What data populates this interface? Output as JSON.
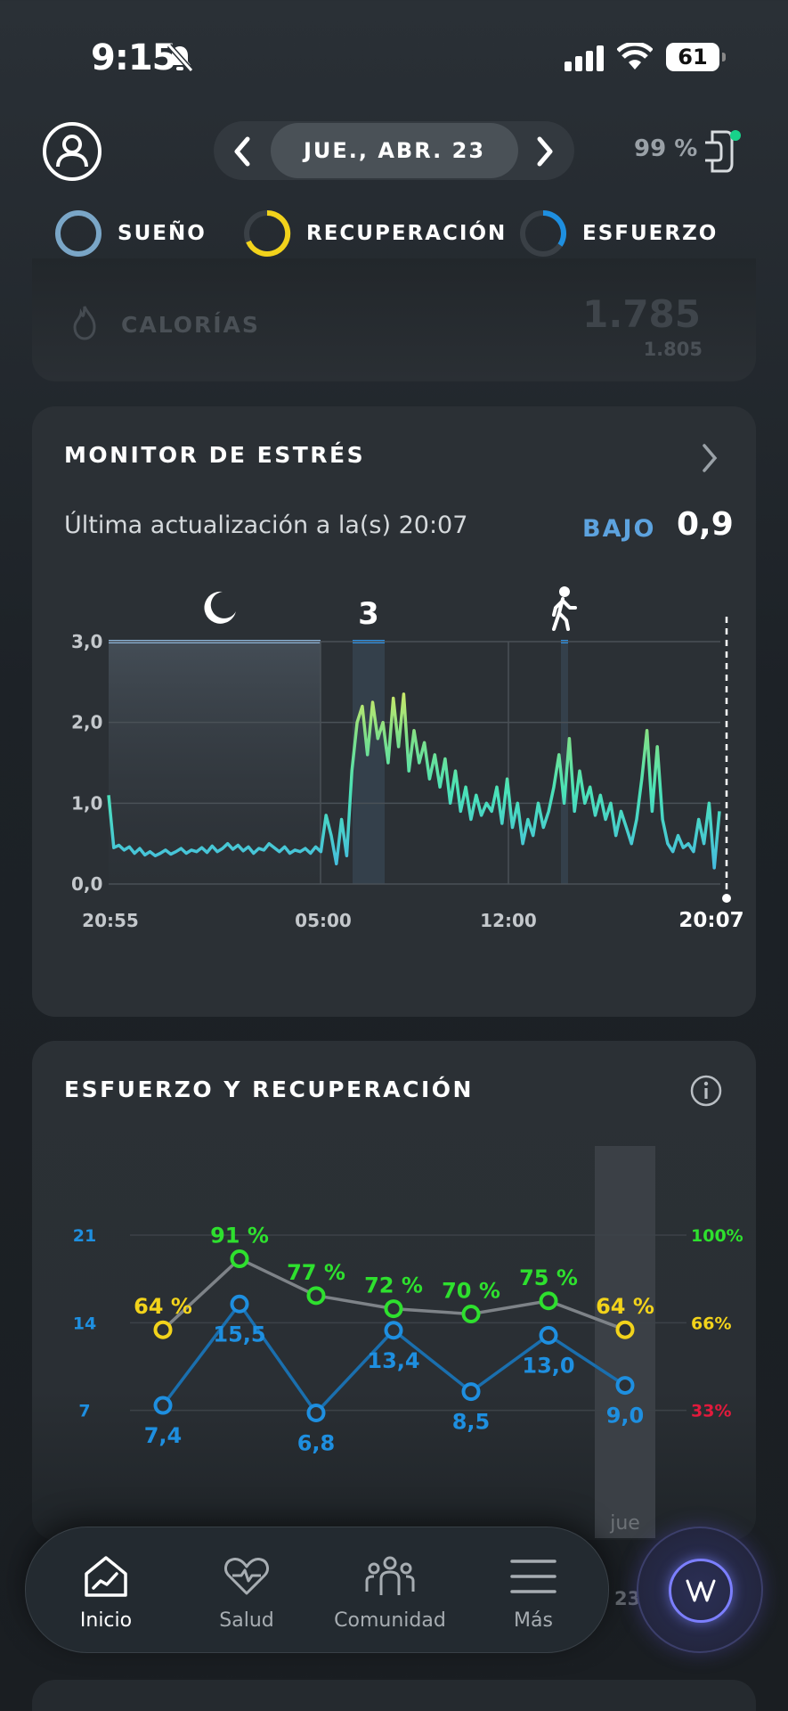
{
  "status": {
    "time": "9:15",
    "battery": "61"
  },
  "header": {
    "date": "JUE., ABR. 23",
    "strap_battery": "99 %"
  },
  "dials": [
    {
      "label": "SUEÑO",
      "color": "#7aa6c7"
    },
    {
      "label": "RECUPERACIÓN",
      "color": "#f2d31b"
    },
    {
      "label": "ESFUERZO",
      "color": "#1e8fe0"
    }
  ],
  "calories": {
    "label": "CALORÍAS",
    "value": "1.785",
    "sub": "1.805"
  },
  "stress": {
    "title": "MONITOR DE ESTRÉS",
    "updated": "Última actualización a la(s) 20:07",
    "level_word": "BAJO",
    "level_value": "0,9",
    "marker_count": "3",
    "chart_data": {
      "type": "line",
      "ylim": [
        0,
        3
      ],
      "y_ticks": [
        "3,0",
        "2,0",
        "1,0",
        "0,0"
      ],
      "x_ticks": [
        "20:55",
        "05:00",
        "12:00",
        "20:07"
      ],
      "series": [
        {
          "values": [
            1.1,
            0.45,
            0.48,
            0.42,
            0.46,
            0.38,
            0.44,
            0.36,
            0.4,
            0.35,
            0.38,
            0.42,
            0.37,
            0.4,
            0.44,
            0.38,
            0.42,
            0.4,
            0.45,
            0.39,
            0.47,
            0.4,
            0.44,
            0.5,
            0.43,
            0.48,
            0.41,
            0.46,
            0.38,
            0.44,
            0.42,
            0.5,
            0.45,
            0.4,
            0.46,
            0.38,
            0.42,
            0.4,
            0.44,
            0.38,
            0.46,
            0.4,
            0.85,
            0.6,
            0.25,
            0.8,
            0.35,
            1.4,
            2.0,
            2.2,
            1.6,
            2.25,
            1.8,
            2.0,
            1.5,
            2.3,
            1.7,
            2.35,
            1.4,
            1.9,
            1.5,
            1.75,
            1.3,
            1.6,
            1.2,
            1.55,
            1.0,
            1.4,
            0.9,
            1.2,
            0.8,
            1.1,
            0.85,
            1.0,
            0.9,
            1.2,
            0.75,
            1.3,
            0.7,
            1.0,
            0.5,
            0.8,
            0.6,
            1.0,
            0.7,
            0.9,
            1.2,
            1.6,
            1.0,
            1.8,
            0.9,
            1.4,
            1.0,
            1.2,
            0.85,
            1.1,
            0.8,
            1.0,
            0.6,
            0.9,
            0.7,
            0.5,
            0.8,
            1.3,
            1.9,
            0.9,
            1.7,
            0.8,
            0.5,
            0.4,
            0.6,
            0.45,
            0.5,
            0.4,
            0.8,
            0.5,
            1.0,
            0.2,
            0.9
          ]
        }
      ]
    }
  },
  "effort": {
    "title": "ESFUERZO Y RECUPERACIÓN",
    "chart_data": {
      "type": "line",
      "left_ticks": [
        "21",
        "14",
        "7"
      ],
      "right_ticks": [
        "100%",
        "66%",
        "33%"
      ],
      "series": [
        {
          "values": [
            64,
            91,
            77,
            72,
            70,
            75,
            64
          ],
          "labels": [
            "64 %",
            "91 %",
            "77 %",
            "72 %",
            "70 %",
            "75 %",
            "64 %"
          ]
        },
        {
          "values": [
            7.4,
            15.5,
            6.8,
            13.4,
            8.5,
            13.0,
            9.0
          ],
          "labels": [
            "7,4",
            "15,5",
            "6,8",
            "13,4",
            "8,5",
            "13,0",
            "9,0"
          ]
        }
      ],
      "highlight_label": "jue",
      "highlight_sub": "23"
    }
  },
  "nav": [
    {
      "label": "Inicio",
      "icon": "home-chart-icon"
    },
    {
      "label": "Salud",
      "icon": "heart-pulse-icon"
    },
    {
      "label": "Comunidad",
      "icon": "community-icon"
    },
    {
      "label": "Más",
      "icon": "menu-icon"
    }
  ]
}
